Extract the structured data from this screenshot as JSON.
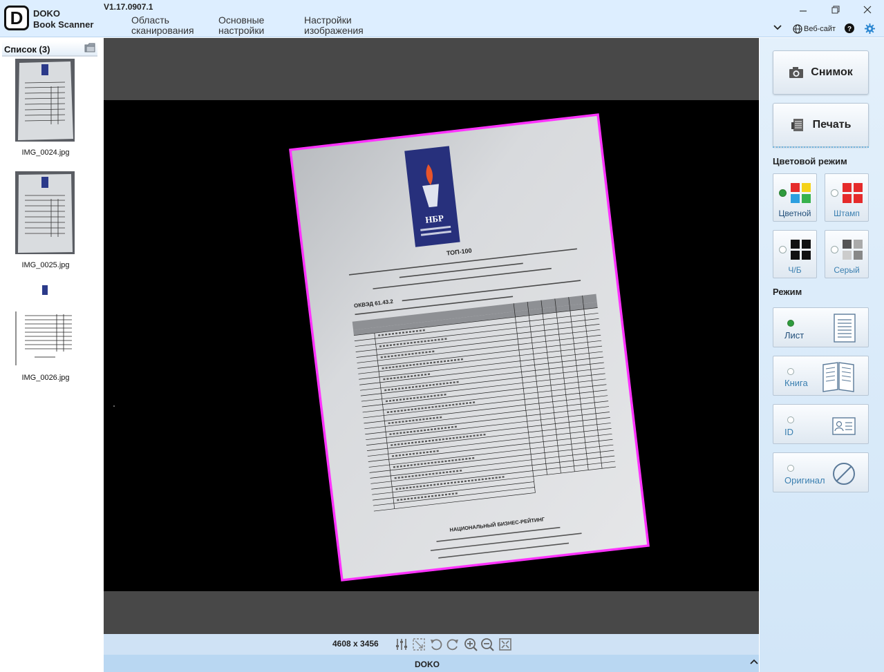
{
  "app": {
    "logo_letter": "D",
    "logo_line1": "DOKO",
    "logo_line2": "Book Scanner",
    "version": "V1.17.0907.1"
  },
  "menu": [
    {
      "line1": "Область",
      "line2": "сканирования"
    },
    {
      "line1": "Основные",
      "line2": "настройки"
    },
    {
      "line1": "Настройки",
      "line2": "изображения"
    }
  ],
  "titlebar": {
    "website_label": "Веб-сайт",
    "icons": [
      "minimize-icon",
      "restore-icon",
      "close-icon",
      "chevron-down-icon",
      "globe-icon",
      "help-icon",
      "gear-icon"
    ]
  },
  "list": {
    "title": "Список (3)",
    "items": [
      {
        "filename": "IMG_0024.jpg"
      },
      {
        "filename": "IMG_0025.jpg"
      },
      {
        "filename": "IMG_0026.jpg"
      }
    ]
  },
  "viewer": {
    "resolution": "4608 x 3456",
    "status": "DOKO",
    "crop_color": "#ff33ff",
    "tools": [
      "adjust-icon",
      "auto-crop-icon",
      "rotate-left-icon",
      "rotate-right-icon",
      "zoom-in-icon",
      "zoom-out-icon",
      "fit-screen-icon"
    ],
    "document": {
      "logo_text": "НБР",
      "title": "ТОП-100",
      "footer_title": "НАЦИОНАЛЬНЫЙ БИЗНЕС-РЕЙТИНГ",
      "okved": "ОКВЭД   61.43.2"
    }
  },
  "right": {
    "snapshot_label": "Снимок",
    "print_label": "Печать",
    "color_mode_title": "Цветовой режим",
    "color_modes": [
      {
        "label": "Цветной",
        "selected": true
      },
      {
        "label": "Штамп",
        "selected": false
      },
      {
        "label": "Ч/Б",
        "selected": false
      },
      {
        "label": "Серый",
        "selected": false
      }
    ],
    "mode_title": "Режим",
    "modes": [
      {
        "label": "Лист",
        "selected": true
      },
      {
        "label": "Книга",
        "selected": false
      },
      {
        "label": "ID",
        "selected": false
      },
      {
        "label": "Оригинал",
        "selected": false
      }
    ]
  }
}
